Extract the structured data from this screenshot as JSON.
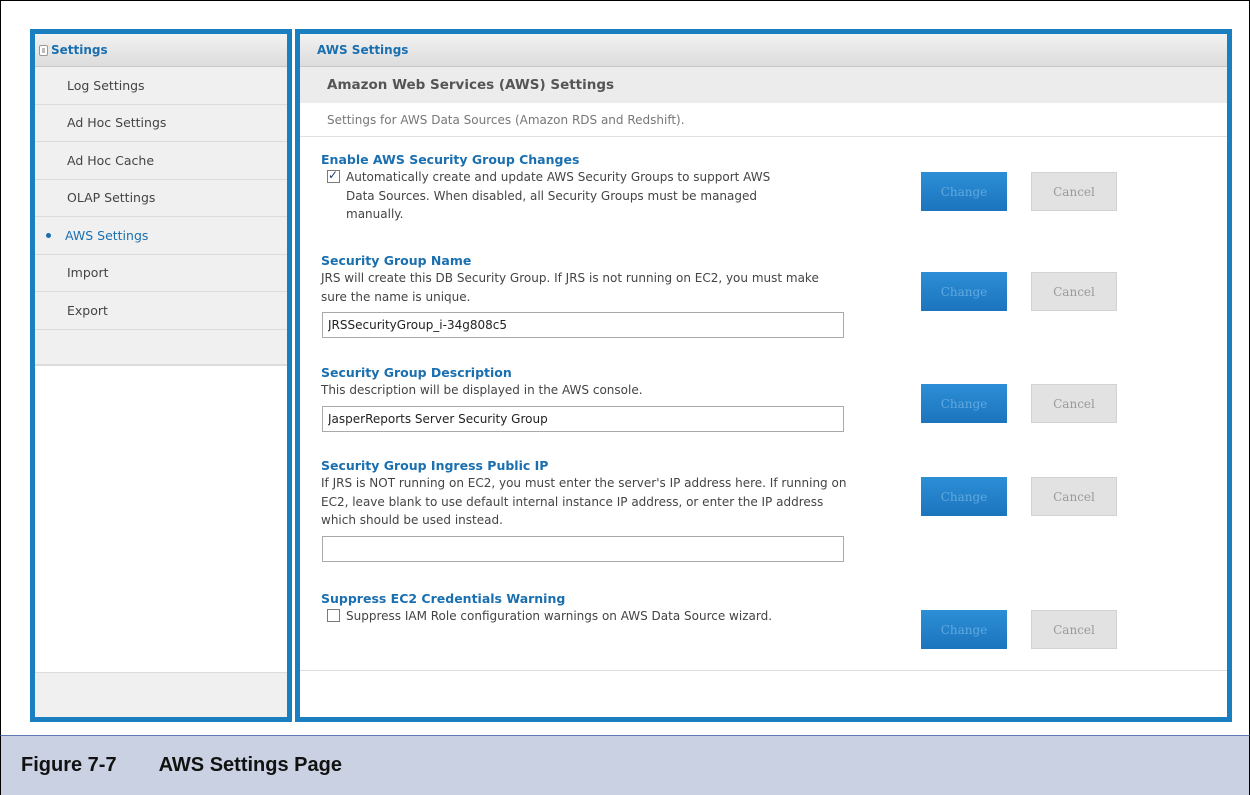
{
  "sidebar": {
    "title": "Settings",
    "items": [
      {
        "label": "Log Settings"
      },
      {
        "label": "Ad Hoc Settings"
      },
      {
        "label": "Ad Hoc Cache"
      },
      {
        "label": "OLAP Settings"
      },
      {
        "label": "AWS Settings",
        "active": true
      },
      {
        "label": "Import"
      },
      {
        "label": "Export"
      }
    ]
  },
  "main": {
    "title": "AWS Settings",
    "subtitle": "Amazon Web Services (AWS) Settings",
    "description": "Settings for AWS Data Sources (Amazon RDS and Redshift).",
    "sections": [
      {
        "title": "Enable AWS Security Group Changes",
        "checkbox_checked": true,
        "text": "Automatically create and update AWS Security Groups to support AWS Data Sources. When disabled, all Security Groups must be managed manually."
      },
      {
        "title": "Security Group Name",
        "text": "JRS will create this DB Security Group. If JRS is not running on EC2, you must make sure the name is unique.",
        "input_value": "JRSSecurityGroup_i-34g808c5"
      },
      {
        "title": "Security Group Description",
        "text": "This description will be displayed in the AWS console.",
        "input_value": "JasperReports Server Security Group"
      },
      {
        "title": "Security Group Ingress Public IP",
        "text": "If JRS is NOT running on EC2, you must enter the server's IP address here. If running on EC2, leave blank to use default internal instance IP address, or enter the IP address which should be used instead.",
        "input_value": ""
      },
      {
        "title": "Suppress EC2 Credentials Warning",
        "checkbox_checked": false,
        "text": "Suppress IAM Role configuration warnings on AWS Data Source wizard."
      }
    ],
    "buttons": {
      "change": "Change",
      "cancel": "Cancel"
    }
  },
  "caption": {
    "number": "Figure 7-7",
    "title": "AWS Settings Page"
  },
  "colors": {
    "accent": "#1a7fc1",
    "link": "#1a6fb0",
    "caption_bg": "#c9d1e2"
  }
}
